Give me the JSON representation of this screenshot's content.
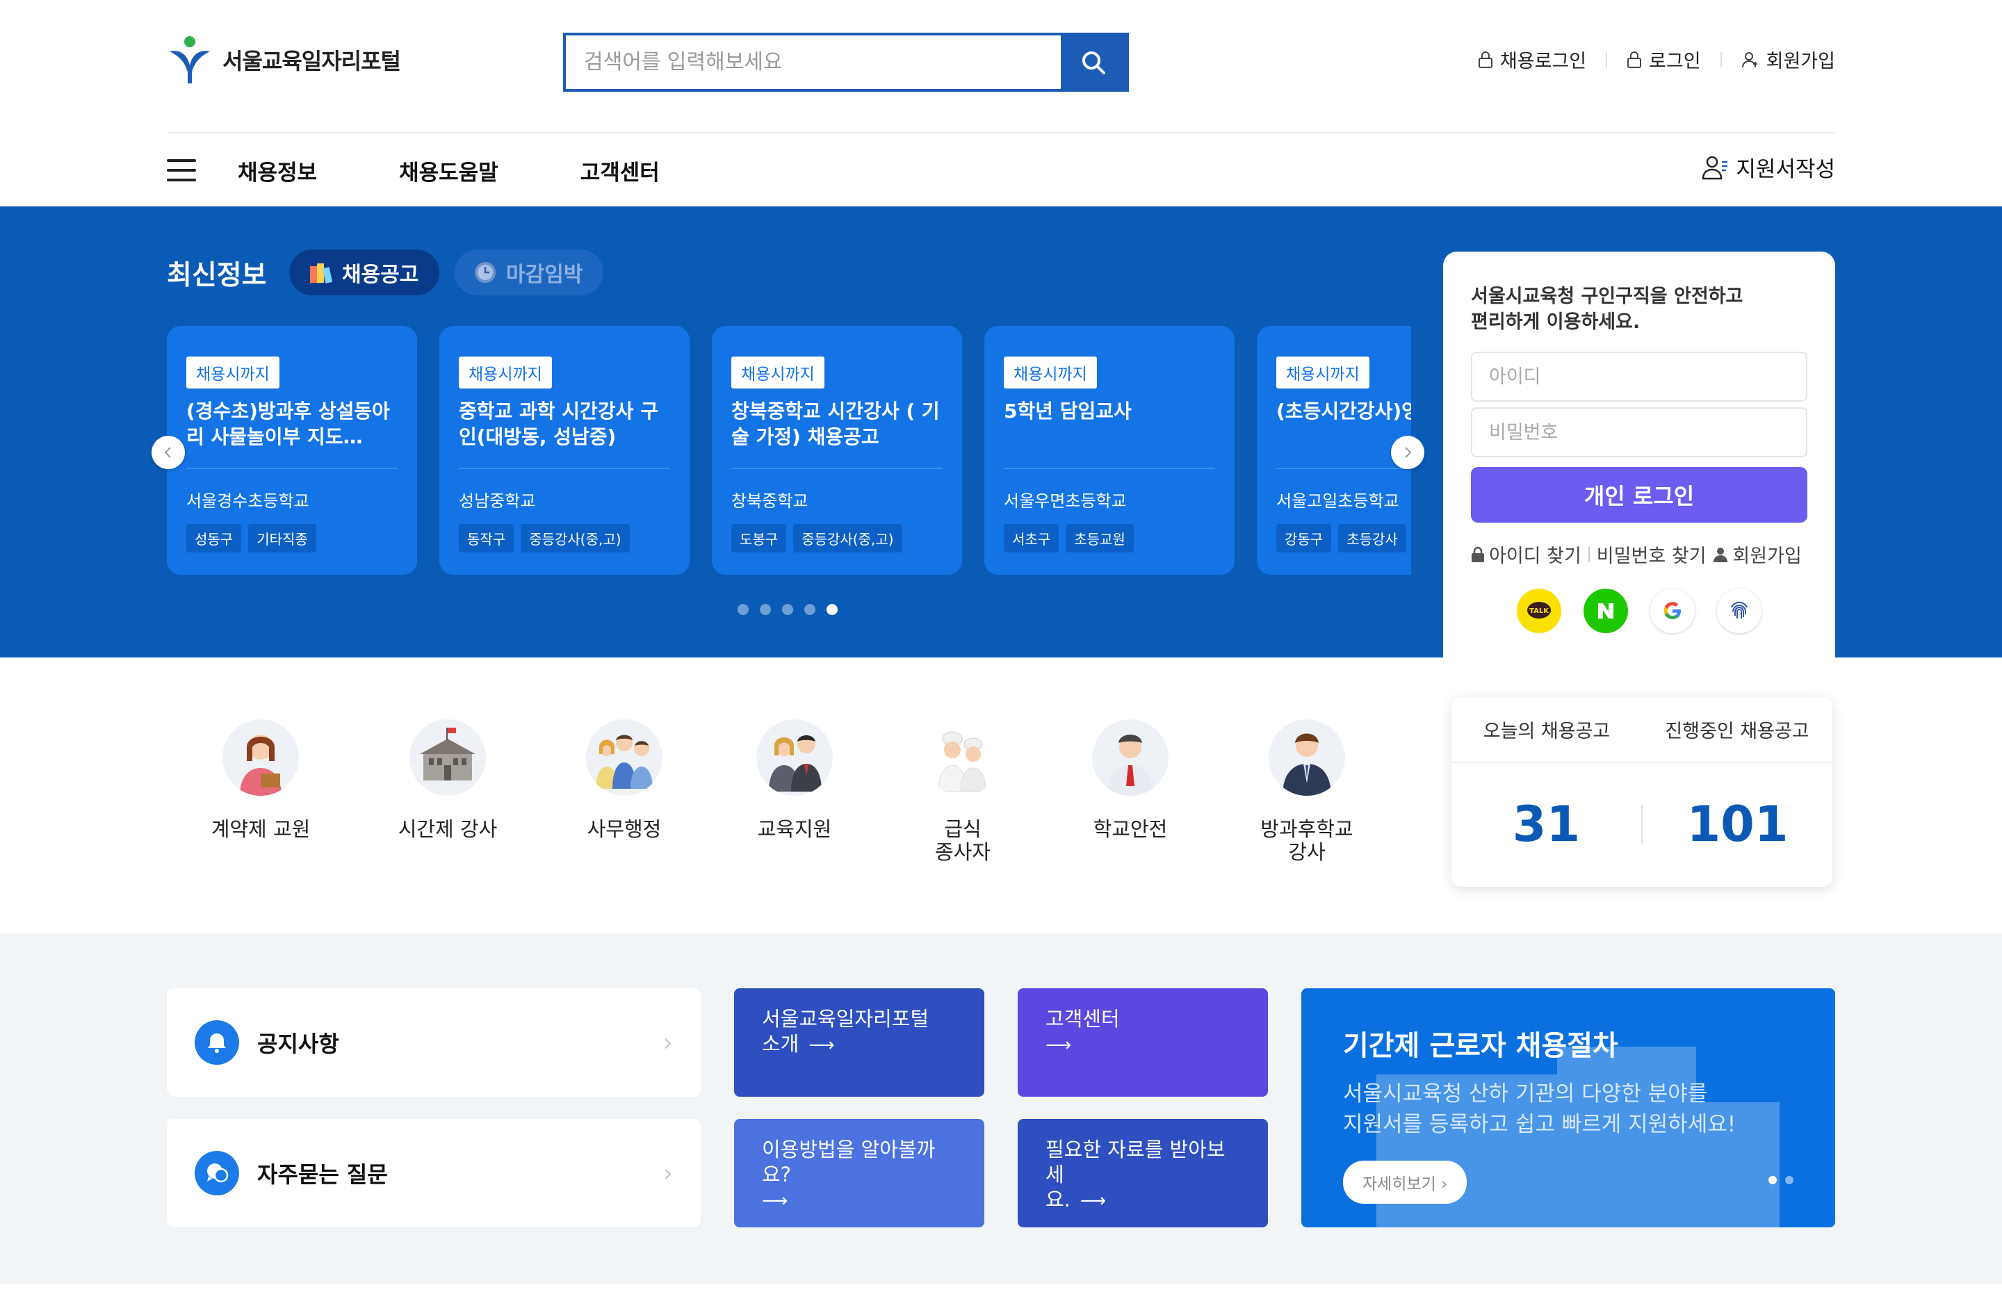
{
  "header": {
    "logo_text": "서울교육일자리포털",
    "search_placeholder": "검색어를 입력해보세요",
    "links": [
      "채용로그인",
      "로그인",
      "회원가입"
    ]
  },
  "nav": {
    "menus": [
      "채용정보",
      "채용도움말",
      "고객센터"
    ],
    "apply_label": "지원서작성"
  },
  "latest": {
    "title": "최신정보",
    "tabs": [
      "채용공고",
      "마감임박"
    ],
    "cards": [
      {
        "badge": "채용시까지",
        "title": "(경수초)방과후 상설동아리 사물놀이부 지도…",
        "school": "서울경수초등학교",
        "tags": [
          "성동구",
          "기타직종"
        ]
      },
      {
        "badge": "채용시까지",
        "title": "중학교 과학 시간강사 구인(대방동, 성남중)",
        "school": "성남중학교",
        "tags": [
          "동작구",
          "중등강사(중,고)"
        ]
      },
      {
        "badge": "채용시까지",
        "title": "창북중학교 시간강사 ( 기술 가정) 채용공고",
        "school": "창북중학교",
        "tags": [
          "도봉구",
          "중등강사(중,고)"
        ]
      },
      {
        "badge": "채용시까지",
        "title": "5학년 담임교사",
        "school": "서울우면초등학교",
        "tags": [
          "서초구",
          "초등교원"
        ]
      },
      {
        "badge": "채용시까지",
        "title": "(초등시간강사)영과",
        "school": "서울고일초등학교",
        "tags": [
          "강동구",
          "초등강사"
        ]
      }
    ],
    "active_dot": 4,
    "dot_count": 5
  },
  "login": {
    "message_line1": "서울시교육청 구인구직을 안전하고",
    "message_line2": "편리하게 이용하세요.",
    "id_placeholder": "아이디",
    "pw_placeholder": "비밀번호",
    "login_button": "개인 로그인",
    "find_id": "아이디 찾기",
    "find_pw": "비밀번호 찾기",
    "signup": "회원가입",
    "social": [
      "kakao",
      "naver",
      "google",
      "fingerprint"
    ]
  },
  "categories": [
    {
      "label": "계약제 교원",
      "icon": "teacher-icon"
    },
    {
      "label": "시간제 강사",
      "icon": "school-building-icon"
    },
    {
      "label": "사무행정",
      "icon": "office-workers-icon"
    },
    {
      "label": "교육지원",
      "icon": "education-support-icon"
    },
    {
      "label": "급식\n종사자",
      "icon": "chef-icon"
    },
    {
      "label": "학교안전",
      "icon": "security-guard-icon"
    },
    {
      "label": "방과후학교\n강사",
      "icon": "instructor-icon"
    }
  ],
  "stats": {
    "today_label": "오늘의 채용공고",
    "ongoing_label": "진행중인 채용공고",
    "today_value": "31",
    "ongoing_value": "101"
  },
  "quick": {
    "notice": "공지사항",
    "faq": "자주묻는 질문",
    "tiles": [
      {
        "text": "서울교육일자리포털\n소개",
        "color": "#2f4fc0"
      },
      {
        "text": "고객센터",
        "color": "#5a48e0"
      },
      {
        "text": "이용방법을 알아볼까요?",
        "color": "#4b72df"
      },
      {
        "text": "필요한 자료를 받아보세\n요.",
        "color": "#2f4fc0"
      }
    ]
  },
  "promo": {
    "title": "기간제 근로자 채용절차",
    "line1": "서울시교육청 산하 기관의 다양한 분야를",
    "line2": "지원서를 등록하고 쉽고 빠르게 지원하세요!",
    "more": "자세히보기"
  },
  "colors": {
    "brand_blue": "#0a5bb6",
    "card_blue": "#1474e6",
    "login_purple": "#6c5cf0"
  }
}
